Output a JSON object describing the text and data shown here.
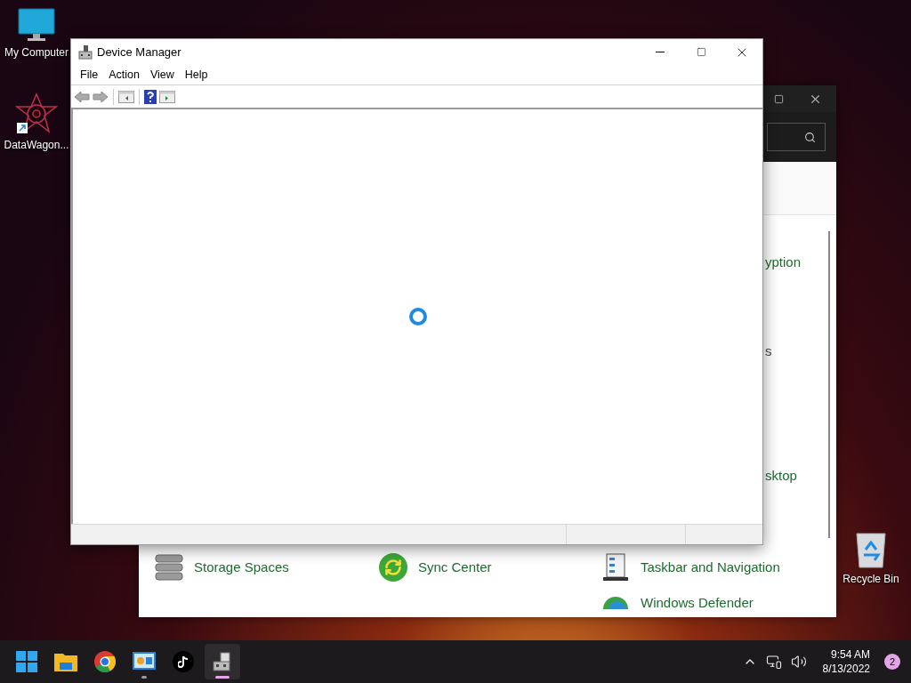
{
  "desktop_icons": [
    {
      "label": "My Computer",
      "kind": "computer"
    },
    {
      "label": "DataWagon...",
      "kind": "shortcut"
    },
    {
      "label": "Recycle Bin",
      "kind": "recycle"
    }
  ],
  "back_window": {
    "fragments": [
      {
        "text": "yption",
        "kind": "link"
      },
      {
        "text": "s",
        "kind": "plain"
      },
      {
        "text": "sktop",
        "kind": "link"
      }
    ],
    "items": [
      {
        "label": "Storage Spaces",
        "kind": "storage"
      },
      {
        "label": "Sync Center",
        "kind": "sync"
      },
      {
        "label": "Taskbar and Navigation",
        "kind": "taskbar"
      },
      {
        "label": "Windows Defender",
        "kind": "defender"
      }
    ]
  },
  "device_manager": {
    "title": "Device Manager",
    "menu": [
      "File",
      "Action",
      "View",
      "Help"
    ],
    "loading": true
  },
  "taskbar": {
    "apps": [
      {
        "kind": "start",
        "running": false,
        "selected": false
      },
      {
        "kind": "folder",
        "running": false,
        "selected": false
      },
      {
        "kind": "browser",
        "running": false,
        "selected": false
      },
      {
        "kind": "remote",
        "running": true,
        "selected": false
      },
      {
        "kind": "music",
        "running": false,
        "selected": false
      },
      {
        "kind": "devices",
        "running": true,
        "selected": true
      }
    ],
    "time": "9:54 AM",
    "date": "8/13/2022",
    "notifications": "2"
  }
}
